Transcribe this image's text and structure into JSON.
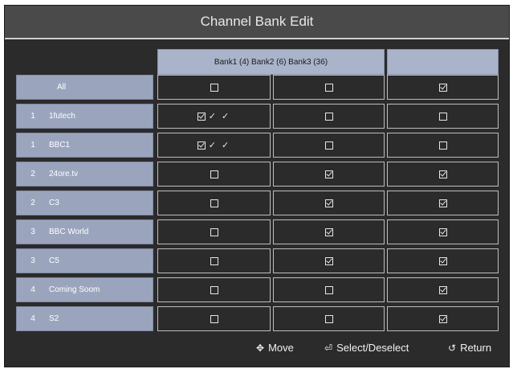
{
  "title": "Channel Bank Edit",
  "header": {
    "bank_labels": "Bank1 (4) Bank2 (6) Bank3 (36)"
  },
  "rows": [
    {
      "num": "",
      "name": "All",
      "bank1": false,
      "bank1_ticks": "",
      "bank2": false,
      "bank3": true
    },
    {
      "num": "1",
      "name": "1futech",
      "bank1": true,
      "bank1_ticks": "✓ ✓",
      "bank2": false,
      "bank3": false
    },
    {
      "num": "1",
      "name": "BBC1",
      "bank1": true,
      "bank1_ticks": "✓ ✓",
      "bank2": false,
      "bank3": false
    },
    {
      "num": "2",
      "name": "24ore.tv",
      "bank1": false,
      "bank1_ticks": "",
      "bank2": true,
      "bank3": true
    },
    {
      "num": "2",
      "name": "C3",
      "bank1": false,
      "bank1_ticks": "",
      "bank2": true,
      "bank3": true
    },
    {
      "num": "3",
      "name": "BBC World",
      "bank1": false,
      "bank1_ticks": "",
      "bank2": true,
      "bank3": true
    },
    {
      "num": "3",
      "name": "C5",
      "bank1": false,
      "bank1_ticks": "",
      "bank2": true,
      "bank3": true
    },
    {
      "num": "4",
      "name": "Coming Soom",
      "bank1": false,
      "bank1_ticks": "",
      "bank2": false,
      "bank3": true
    },
    {
      "num": "4",
      "name": "S2",
      "bank1": false,
      "bank1_ticks": "",
      "bank2": false,
      "bank3": true
    }
  ],
  "footer": {
    "move_label": "Move",
    "select_label": "Select/Deselect",
    "return_label": "Return",
    "move_icon": "dpad-icon",
    "select_icon": "enter-icon",
    "return_icon": "return-icon"
  }
}
